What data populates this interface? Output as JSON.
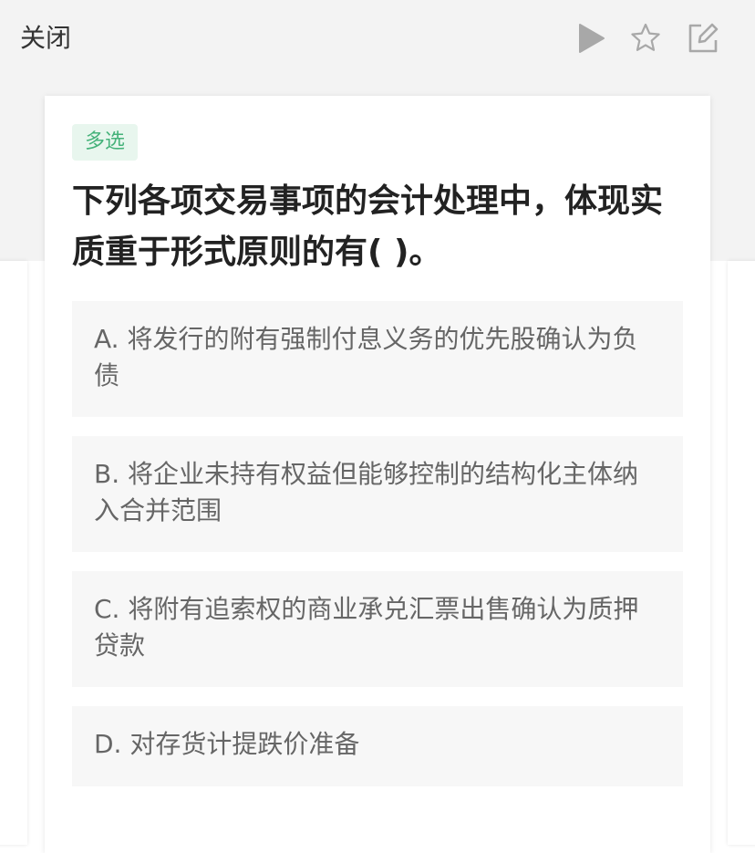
{
  "header": {
    "close_label": "关闭",
    "icons": [
      "play-icon",
      "star-icon",
      "edit-note-icon"
    ]
  },
  "question": {
    "type_badge": "多选",
    "text": "下列各项交易事项的会计处理中，体现实质重于形式原则的有( )。",
    "options": [
      {
        "label": "A. 将发行的附有强制付息义务的优先股确认为负债"
      },
      {
        "label": "B. 将企业未持有权益但能够控制的结构化主体纳入合并范围"
      },
      {
        "label": "C. 将附有追索权的商业承兑汇票出售确认为质押贷款"
      },
      {
        "label": "D. 对存货计提跌价准备"
      }
    ]
  },
  "colors": {
    "header_background": "#f3f3f3",
    "badge_background": "#e8f6ee",
    "badge_text": "#45b27a",
    "option_background": "#f7f7f7",
    "option_text": "#666666",
    "icon_gray": "#a8a8a8"
  }
}
